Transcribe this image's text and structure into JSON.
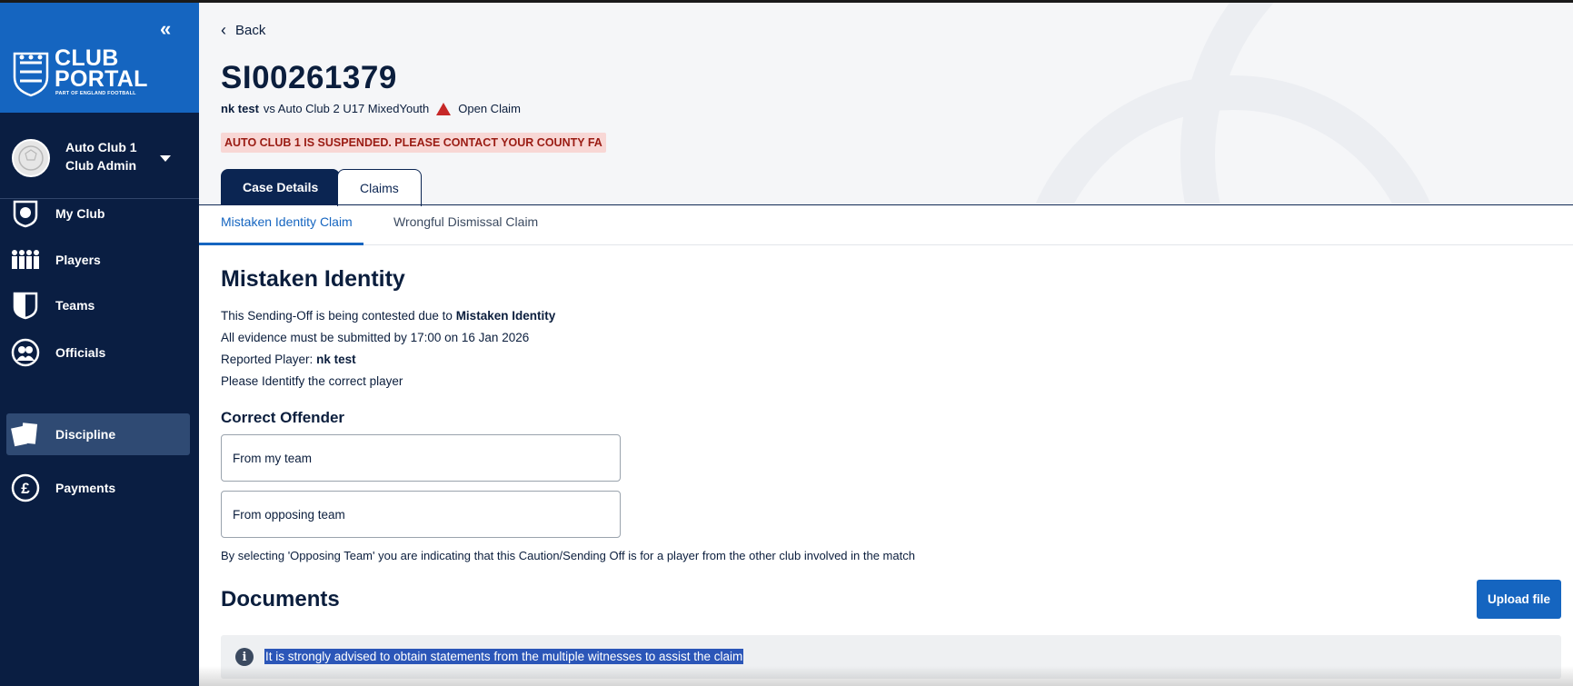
{
  "sidebar": {
    "collapse_glyph": "«",
    "logo": {
      "line1": "CLUB",
      "line2": "PORTAL",
      "sub": "PART OF ENGLAND FOOTBALL"
    },
    "club": {
      "name": "Auto Club 1",
      "role": "Club Admin"
    },
    "items": [
      {
        "label": "My Club",
        "icon": "shield-ball-icon"
      },
      {
        "label": "Players",
        "icon": "players-icon"
      },
      {
        "label": "Teams",
        "icon": "shield-icon"
      },
      {
        "label": "Officials",
        "icon": "officials-icon"
      },
      {
        "label": "Discipline",
        "icon": "cards-icon",
        "active": true
      },
      {
        "label": "Payments",
        "icon": "pound-icon"
      }
    ]
  },
  "header": {
    "back_label": "Back",
    "case_id": "SI00261379",
    "player": "nk test",
    "match": "vs Auto Club 2 U17 MixedYouth",
    "status": "Open Claim",
    "alert": "AUTO CLUB 1 IS SUSPENDED. PLEASE CONTACT YOUR COUNTY FA"
  },
  "tabs": [
    {
      "label": "Case Details",
      "selected": false
    },
    {
      "label": "Claims",
      "selected": true
    }
  ],
  "subtabs": [
    {
      "label": "Mistaken Identity Claim",
      "selected": true
    },
    {
      "label": "Wrongful Dismissal Claim",
      "selected": false
    }
  ],
  "claim": {
    "title": "Mistaken Identity",
    "line1_prefix": "This Sending-Off is being contested due to",
    "line1_bold": "Mistaken Identity",
    "line2": "All evidence must be submitted by 17:00 on 16 Jan 2026",
    "line3_prefix": "Reported Player:",
    "line3_bold": "nk test",
    "line4": "Please Identitfy the correct player",
    "offender_title": "Correct Offender",
    "options": [
      "From my team",
      "From opposing team"
    ],
    "note": "By selecting 'Opposing Team' you are indicating that this Caution/Sending Off is for a player from the other club involved in the match"
  },
  "documents": {
    "title": "Documents",
    "upload_label": "Upload file",
    "info_text": "It is strongly advised to obtain statements from the multiple witnesses to assist the claim"
  },
  "colors": {
    "sidebar_bg": "#0a1e42",
    "brand_blue": "#1565c0",
    "dark_navy": "#0b2552",
    "alert_bg": "#f8d7d5",
    "alert_text": "#9a1b13",
    "warning_red": "#c62828"
  }
}
